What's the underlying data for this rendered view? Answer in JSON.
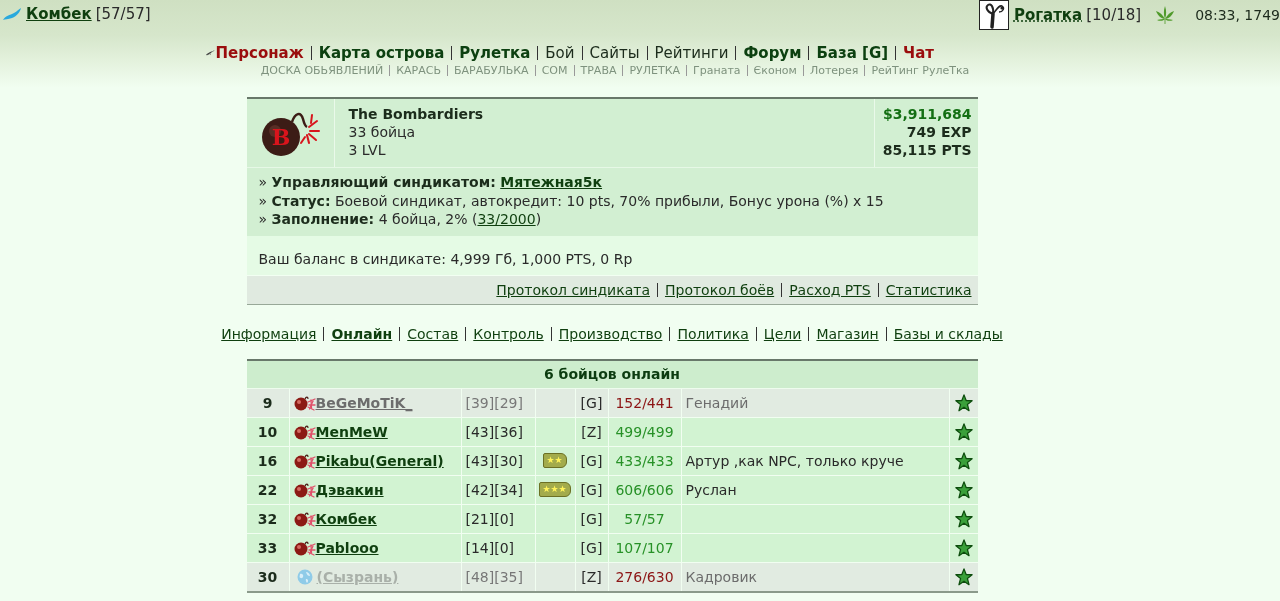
{
  "top_bar": {
    "user": {
      "name": "Комбек",
      "hp": "[57/57]"
    },
    "weapon": {
      "name": "Рогатка",
      "ammo": "[10/18]"
    },
    "time": "08:33, 1749"
  },
  "main_nav": [
    {
      "label": "Персонаж",
      "kind": "accent"
    },
    {
      "label": "Карта острова",
      "kind": "bold"
    },
    {
      "label": "Рулетка",
      "kind": "bold"
    },
    {
      "label": "Бой",
      "kind": "plain"
    },
    {
      "label": "Сайты",
      "kind": "plain"
    },
    {
      "label": "Рейтинги",
      "kind": "plain"
    },
    {
      "label": "Форум",
      "kind": "bold"
    },
    {
      "label": "База [G]",
      "kind": "bold"
    },
    {
      "label": "Чат",
      "kind": "accent"
    }
  ],
  "sub_nav": [
    "ДОСКА ОБЬЯВЛЕНИЙ",
    "КАРАСЬ",
    "БАРАБУЛЬКА",
    "СОМ",
    "ТРАВА",
    "РУЛЕТКА",
    "Граната",
    "Єконом",
    "Лотерея",
    "РейТинг РулеТка"
  ],
  "syndicate": {
    "logo": "B",
    "name": "The Bombardiers",
    "members": "33 бойца",
    "level": "3 LVL",
    "money": "$3,911,684",
    "exp": "749 EXP",
    "pts": "85,115 PTS",
    "details": [
      {
        "text": "» **Управляющий синдикатом:** ",
        "link": "Мятежная5к"
      },
      {
        "text": "» **Статус:** Боевой синдикат, автокредит: 10 pts, 70% прибыли, Бонус урона (%) x 15"
      },
      {
        "text": "» **Заполнение:** 4 бойца, 2% (",
        "link": "33/2000",
        "after": ")"
      }
    ],
    "balance": "Ваш баланс в синдикате: 4,999 Гб, 1,000 PTS, 0 Rp",
    "links": [
      "Протокол синдиката",
      "Протокол боёв",
      "Расход PTS",
      "Статистика"
    ]
  },
  "tabs": [
    {
      "label": "Информация",
      "selected": false
    },
    {
      "label": "Онлайн",
      "selected": true
    },
    {
      "label": "Состав",
      "selected": false
    },
    {
      "label": "Контроль",
      "selected": false
    },
    {
      "label": "Производство",
      "selected": false
    },
    {
      "label": "Политика",
      "selected": false
    },
    {
      "label": "Цели",
      "selected": false
    },
    {
      "label": "Магазин",
      "selected": false
    },
    {
      "label": "Базы и склады",
      "selected": false
    }
  ],
  "online": {
    "title": "6 бойцов онлайн",
    "rows": [
      {
        "rank": "9",
        "kind": "member",
        "away": true,
        "name": "BeGeMoTiK_",
        "levels": "[39][29]",
        "clan": "[G]",
        "hp": "152/441",
        "hp_full": false,
        "note": "Генадий"
      },
      {
        "rank": "10",
        "kind": "member",
        "away": false,
        "name": "MenMeW",
        "levels": "[43][36]",
        "clan": "[Z]",
        "hp": "499/499",
        "hp_full": true
      },
      {
        "rank": "16",
        "kind": "member",
        "away": false,
        "name": "Pikabu(General)",
        "levels": "[43][30]",
        "insignia": "★★",
        "clan": "[G]",
        "hp": "433/433",
        "hp_full": true,
        "note": "Артур ,как NPC, только круче"
      },
      {
        "rank": "22",
        "kind": "member",
        "away": false,
        "name": "Дэвакин",
        "levels": "[42][34]",
        "insignia": "★★★",
        "clan": "[G]",
        "hp": "606/606",
        "hp_full": true,
        "note": "Руслан"
      },
      {
        "rank": "32",
        "kind": "member",
        "away": false,
        "name": "Комбек",
        "levels": "[21][0]",
        "clan": "[G]",
        "hp": "57/57",
        "hp_full": true
      },
      {
        "rank": "33",
        "kind": "member",
        "away": false,
        "name": "Pablooo",
        "levels": "[14][0]",
        "clan": "[G]",
        "hp": "107/107",
        "hp_full": true
      },
      {
        "rank": "30",
        "kind": "guest",
        "away": true,
        "name": "(Сызрань)",
        "levels": "[48][35]",
        "clan": "[Z]",
        "hp": "276/630",
        "hp_full": false,
        "note": "Кадровик"
      }
    ]
  }
}
